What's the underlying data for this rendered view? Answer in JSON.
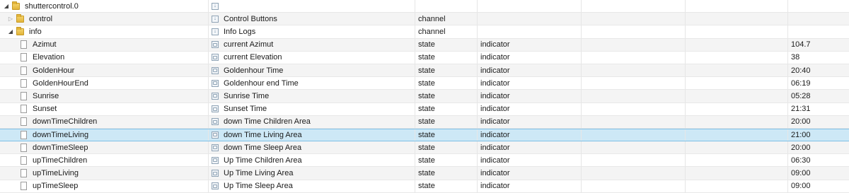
{
  "root": {
    "label": "shuttercontrol.0"
  },
  "rows": [
    {
      "name": "control",
      "role": "Control Buttons",
      "type": "channel",
      "indicator": "",
      "value": ""
    },
    {
      "name": "info",
      "role": "Info Logs",
      "type": "channel",
      "indicator": "",
      "value": ""
    },
    {
      "name": "Azimut",
      "role": "current Azimut",
      "type": "state",
      "indicator": "indicator",
      "value": "104.7"
    },
    {
      "name": "Elevation",
      "role": "current Elevation",
      "type": "state",
      "indicator": "indicator",
      "value": "38"
    },
    {
      "name": "GoldenHour",
      "role": "Goldenhour Time",
      "type": "state",
      "indicator": "indicator",
      "value": "20:40"
    },
    {
      "name": "GoldenHourEnd",
      "role": "Goldenhour end Time",
      "type": "state",
      "indicator": "indicator",
      "value": "06:19"
    },
    {
      "name": "Sunrise",
      "role": "Sunrise Time",
      "type": "state",
      "indicator": "indicator",
      "value": "05:28"
    },
    {
      "name": "Sunset",
      "role": "Sunset Time",
      "type": "state",
      "indicator": "indicator",
      "value": "21:31"
    },
    {
      "name": "downTimeChildren",
      "role": "down Time Children Area",
      "type": "state",
      "indicator": "indicator",
      "value": "20:00"
    },
    {
      "name": "downTimeLiving",
      "role": "down Time Living Area",
      "type": "state",
      "indicator": "indicator",
      "value": "21:00"
    },
    {
      "name": "downTimeSleep",
      "role": "down Time Sleep Area",
      "type": "state",
      "indicator": "indicator",
      "value": "20:00"
    },
    {
      "name": "upTimeChildren",
      "role": "Up Time Children Area",
      "type": "state",
      "indicator": "indicator",
      "value": "06:30"
    },
    {
      "name": "upTimeLiving",
      "role": "Up Time Living Area",
      "type": "state",
      "indicator": "indicator",
      "value": "09:00"
    },
    {
      "name": "upTimeSleep",
      "role": "Up Time Sleep Area",
      "type": "state",
      "indicator": "indicator",
      "value": "09:00"
    }
  ],
  "icons": {
    "expanded": "chevron-expanded-icon",
    "collapsed": "chevron-collapsed-icon",
    "folder": "folder-icon",
    "state": "state-document-icon",
    "channel_role": "channel-role-icon",
    "state_role": "state-role-icon"
  },
  "colors": {
    "selected_row": "#cde8f6",
    "selected_border": "#7fc0e6",
    "folder": "#e2b43a"
  }
}
